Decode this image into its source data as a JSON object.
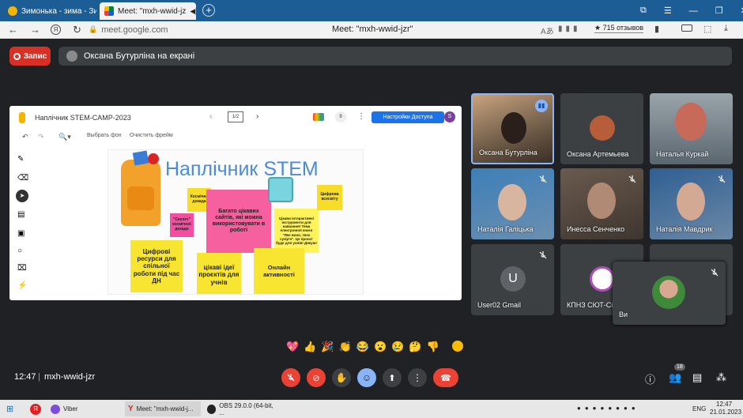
{
  "browser": {
    "tabs": [
      {
        "title": "Зимонька - зима - Зимонь",
        "active": false
      },
      {
        "title": "Meet: \"mxh-wwid-jz",
        "active": true
      }
    ],
    "url": "meet.google.com",
    "page_title": "Meet: \"mxh-wwid-jzr\"",
    "reviews": "★ 715 отзывов"
  },
  "meet": {
    "record_label": "Запис",
    "presenting_label": "Оксана Бутурліна на екрані",
    "time": "12:47",
    "meeting_code": "mxh-wwid-jzr",
    "people_badge": "18",
    "participants": [
      {
        "name": "Оксана Бутурліна",
        "speaking": true
      },
      {
        "name": "Оксана Артемьева",
        "speaking": false
      },
      {
        "name": "Наталья Куркай",
        "speaking": false
      },
      {
        "name": "Наталія Галіцька",
        "speaking": false
      },
      {
        "name": "Инесса Сенченко",
        "speaking": false
      },
      {
        "name": "Наталія Мавдрик",
        "speaking": false
      },
      {
        "name": "User02 Gmail",
        "initial": "U"
      },
      {
        "name": "КПНЗ СЮТ-Сі"
      },
      {
        "name": "Ви"
      }
    ],
    "reactions": [
      "💖",
      "👍",
      "🎉",
      "👏",
      "😂",
      "😮",
      "😢",
      "🤔",
      "👎"
    ]
  },
  "jamboard": {
    "title": "Наплічник STEM-CAMP-2023",
    "frame_counter": "1/2",
    "share_button": "Настройки Доступа",
    "user_initial": "S",
    "count_badge": "9",
    "tool_bg": "Выбрать фон",
    "tool_clear": "Очистить фрейм",
    "canvas_title": "Наплічник STEM",
    "stickies": {
      "kosm": "Космічна декада",
      "skelet": "\"Скелет\" космічної декади",
      "bagato": "Багато цікавих сайтів, які можна використовувати в роботі",
      "cikavi_tools": "Цікави інтерактивні інструменти для навчання! Тема електронної книги \"Яке воно, твоє сузір'я\". Це проєкт буде для учнів! Дякую!",
      "tsyfrova": "Цифрова всесвіту",
      "tsyfrovi": "Цифрові ресурси для спільної роботи під час ДН",
      "ideas": "цікаві ідеї проєктів для учнів",
      "online": "Онлайн активності"
    }
  },
  "taskbar": {
    "items": [
      "Viber",
      "Meet: \"mxh-wwid-j...",
      "OBS 29.0.0 (64-bit, ..."
    ],
    "lang": "ENG",
    "time": "12:47",
    "date": "21.01.2023"
  }
}
